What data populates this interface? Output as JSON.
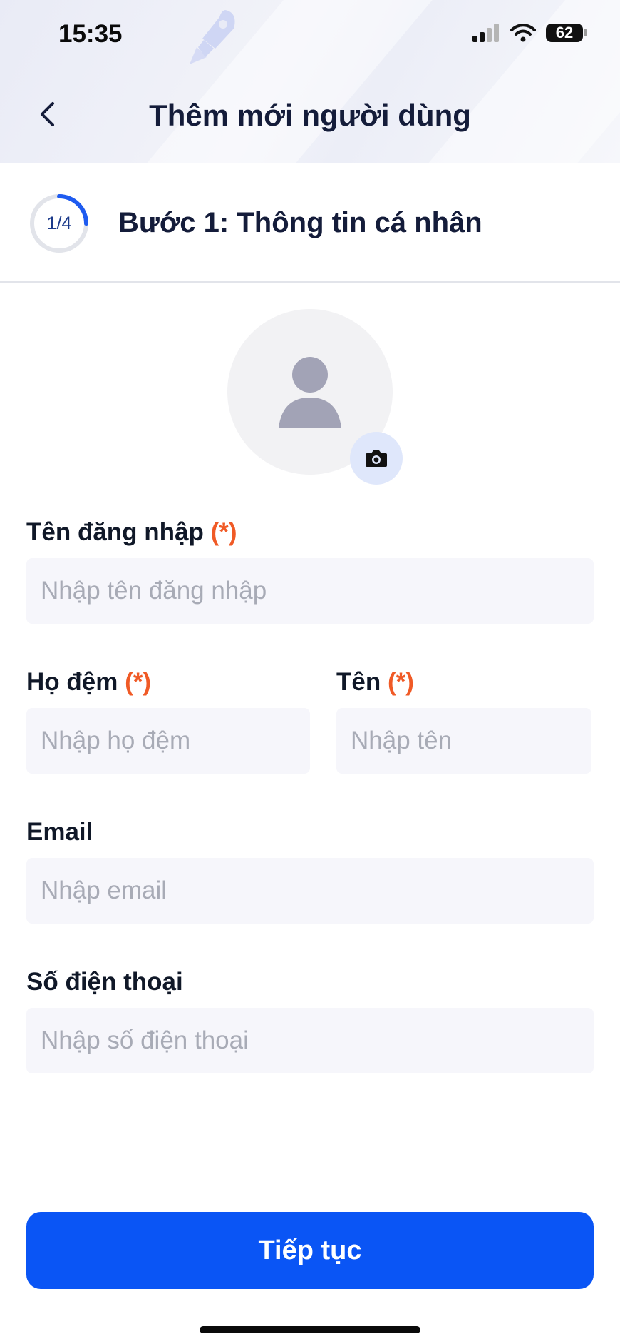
{
  "status_bar": {
    "time": "15:35",
    "battery": "62"
  },
  "header": {
    "title": "Thêm mới người dùng"
  },
  "step": {
    "counter": "1/4",
    "progress": 0.25,
    "title": "Bước 1: Thông tin cá nhân"
  },
  "form": {
    "username": {
      "label": "Tên đăng nhập",
      "required_mark": "(*)",
      "placeholder": "Nhập tên đăng nhập"
    },
    "middle_name": {
      "label": "Họ đệm",
      "required_mark": "(*)",
      "placeholder": "Nhập họ đệm"
    },
    "first_name": {
      "label": "Tên",
      "required_mark": "(*)",
      "placeholder": "Nhập tên"
    },
    "email": {
      "label": "Email",
      "placeholder": "Nhập email"
    },
    "phone": {
      "label": "Số điện thoại",
      "placeholder": "Nhập số điện thoại"
    }
  },
  "actions": {
    "continue_label": "Tiếp tục"
  },
  "colors": {
    "primary": "#0a55f5",
    "required": "#f05a26",
    "field_bg": "#f6f6fb",
    "title": "#141c3a"
  },
  "icons": {
    "back": "chevron-left-icon",
    "avatar": "user-placeholder-icon",
    "camera": "camera-icon",
    "rocket": "rocket-icon"
  }
}
